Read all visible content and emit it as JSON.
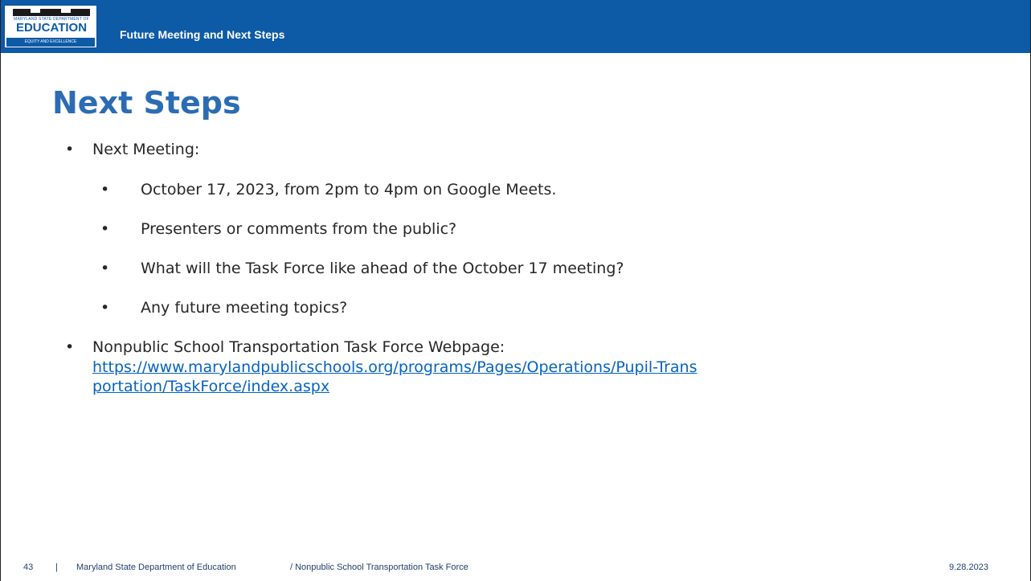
{
  "header": {
    "logo": {
      "small_text": "MARYLAND STATE DEPARTMENT OF",
      "main_text": "EDUCATION",
      "tagline": "EQUITY AND EXCELLENCE"
    },
    "section_title": "Future Meeting and Next Steps"
  },
  "title": "Next Steps",
  "bullets": {
    "next_meeting": "Next Meeting:",
    "sub": [
      "October 17, 2023, from 2pm to 4pm on Google Meets.",
      "Presenters or comments from the public?",
      "What will the Task Force like ahead of the October 17 meeting?",
      "Any future meeting topics?"
    ],
    "webpage_label": "Nonpublic School Transportation Task Force Webpage:",
    "webpage_url": "https://www.marylandpublicschools.org/programs/Pages/Operations/Pupil-Transportation/TaskForce/index.aspx"
  },
  "bullet_glyph": "•",
  "footer": {
    "page_number": "43",
    "separator": "|",
    "organization": "Maryland State Department of Education",
    "task_force": "/ Nonpublic School Transportation Task Force",
    "date": "9.28.2023"
  },
  "colors": {
    "header_blue": "#0d5aa7",
    "title_blue": "#2b6cb4",
    "link_blue": "#0563c1"
  }
}
